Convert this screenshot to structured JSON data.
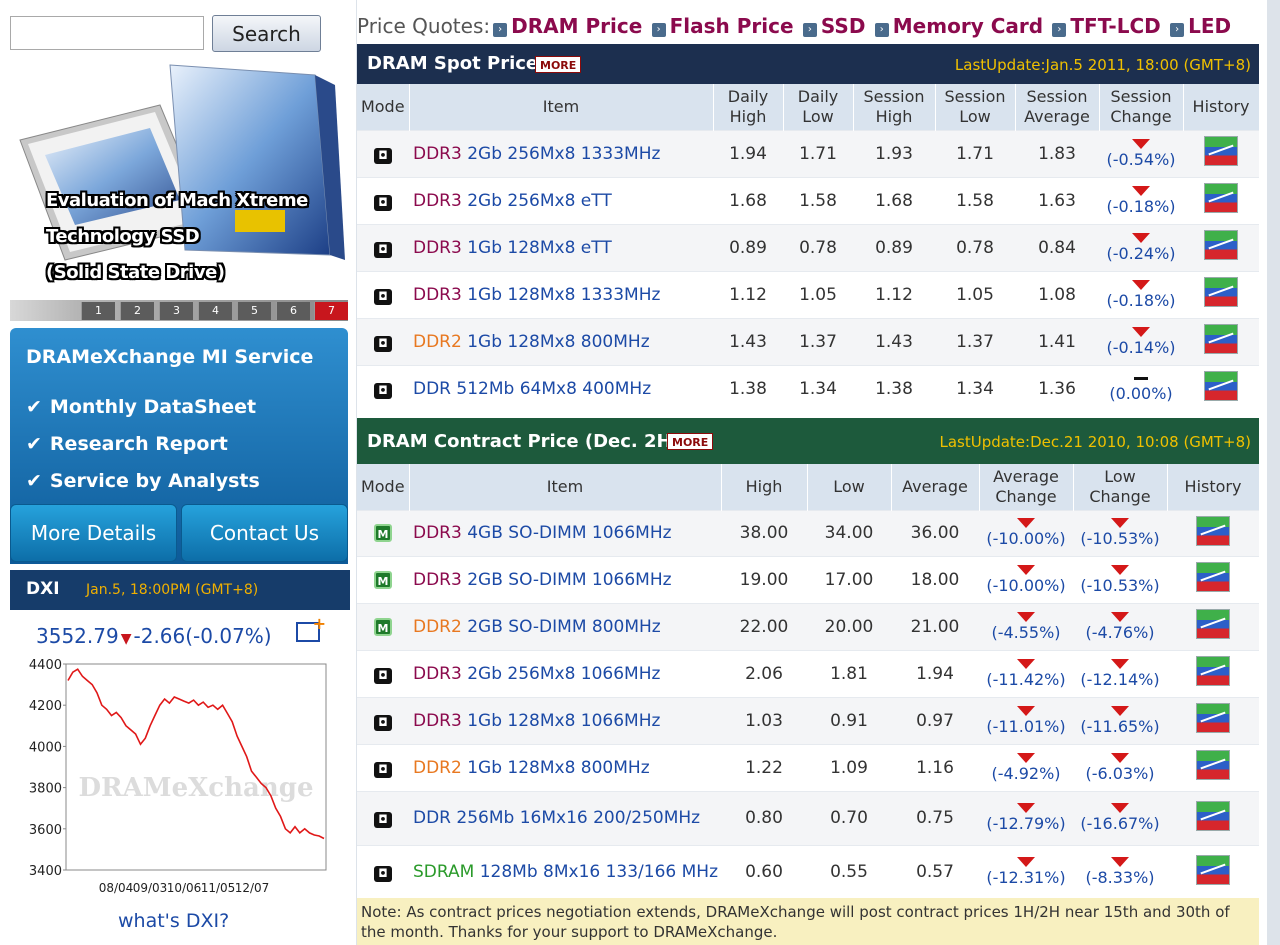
{
  "search": {
    "placeholder": "",
    "button": "Search"
  },
  "banner": {
    "caption_lines": [
      "Evaluation of Mach Xtreme",
      "Technology SSD",
      "(Solid State Drive)"
    ],
    "pages": [
      "1",
      "2",
      "3",
      "4",
      "5",
      "6",
      "7"
    ],
    "active_page": "7"
  },
  "mi_service": {
    "title": "DRAMeXchange MI Service",
    "items": [
      "Monthly DataSheet",
      "Research Report",
      "Service by Analysts"
    ],
    "more_details": "More Details",
    "contact_us": "Contact Us"
  },
  "dxi": {
    "name": "DXI",
    "timestamp": "Jan.5, 18:00PM (GMT+8)",
    "value": "3552.79",
    "change": "-2.66(-0.07%)",
    "whats_link": "what's DXI?"
  },
  "chart_data": {
    "type": "line",
    "watermark": "DRAMeXchange",
    "y_ticks": [
      "4400",
      "4200",
      "4000",
      "3800",
      "3600",
      "3400"
    ],
    "x_ticks": [
      "08/04",
      "09/03",
      "10/06",
      "11/05",
      "12/07"
    ],
    "ylim": [
      3400,
      4400
    ],
    "series": [
      {
        "values": [
          4320,
          4360,
          4375,
          4340,
          4320,
          4300,
          4260,
          4200,
          4180,
          4150,
          4165,
          4140,
          4100,
          4080,
          4060,
          4010,
          4040,
          4100,
          4150,
          4200,
          4230,
          4210,
          4240,
          4230,
          4220,
          4210,
          4225,
          4200,
          4215,
          4190,
          4200,
          4180,
          4200,
          4160,
          4120,
          4050,
          4000,
          3950,
          3880,
          3850,
          3820,
          3800,
          3760,
          3700,
          3660,
          3600,
          3580,
          3610,
          3580,
          3600,
          3580,
          3570,
          3565,
          3553
        ]
      }
    ]
  },
  "colors": {
    "navy": "#163c6a",
    "dark_blue_header": "#1c2f4f",
    "dark_green_header": "#1d5a3c",
    "accent_purple": "#8b0a4d",
    "down_red": "#d41818"
  },
  "quotes_nav": {
    "label": "Price Quotes:",
    "links": [
      "DRAM Price",
      "Flash Price",
      "SSD",
      "Memory Card",
      "TFT-LCD",
      "LED"
    ]
  },
  "spot": {
    "title": "DRAM Spot Price",
    "more": "MORE",
    "last_update": "LastUpdate:Jan.5 2011, 18:00 (GMT+8)",
    "headers": [
      "Mode",
      "Item",
      "Daily High",
      "Daily Low",
      "Session High",
      "Session Low",
      "Session Average",
      "Session Change",
      "History"
    ],
    "rows": [
      {
        "item_type": "DDR3",
        "item_spec": "2Gb 256Mx8 1333MHz",
        "daily_high": "1.94",
        "daily_low": "1.71",
        "session_high": "1.93",
        "session_low": "1.71",
        "session_avg": "1.83",
        "change": "(-0.54%)",
        "dir": "down"
      },
      {
        "item_type": "DDR3",
        "item_spec": "2Gb 256Mx8 eTT",
        "daily_high": "1.68",
        "daily_low": "1.58",
        "session_high": "1.68",
        "session_low": "1.58",
        "session_avg": "1.63",
        "change": "(-0.18%)",
        "dir": "down"
      },
      {
        "item_type": "DDR3",
        "item_spec": "1Gb 128Mx8 eTT",
        "daily_high": "0.89",
        "daily_low": "0.78",
        "session_high": "0.89",
        "session_low": "0.78",
        "session_avg": "0.84",
        "change": "(-0.24%)",
        "dir": "down"
      },
      {
        "item_type": "DDR3",
        "item_spec": "1Gb 128Mx8 1333MHz",
        "daily_high": "1.12",
        "daily_low": "1.05",
        "session_high": "1.12",
        "session_low": "1.05",
        "session_avg": "1.08",
        "change": "(-0.18%)",
        "dir": "down"
      },
      {
        "item_type": "DDR2",
        "item_spec": "1Gb 128Mx8 800MHz",
        "daily_high": "1.43",
        "daily_low": "1.37",
        "session_high": "1.43",
        "session_low": "1.37",
        "session_avg": "1.41",
        "change": "(-0.14%)",
        "dir": "down"
      },
      {
        "item_type": "DDR",
        "item_spec": "512Mb 64Mx8 400MHz",
        "daily_high": "1.38",
        "daily_low": "1.34",
        "session_high": "1.38",
        "session_low": "1.34",
        "session_avg": "1.36",
        "change": "(0.00%)",
        "dir": "flat"
      }
    ]
  },
  "contract": {
    "title": "DRAM Contract Price (Dec. 2H)",
    "more": "MORE",
    "last_update": "LastUpdate:Dec.21 2010, 10:08 (GMT+8)",
    "headers": [
      "Mode",
      "Item",
      "High",
      "Low",
      "Average",
      "Average Change",
      "Low Change",
      "History"
    ],
    "rows": [
      {
        "mode": "M",
        "item_type": "DDR3",
        "item_spec": "4GB SO-DIMM 1066MHz",
        "high": "38.00",
        "low": "34.00",
        "avg": "36.00",
        "avg_change": "(-10.00%)",
        "low_change": "(-10.53%)"
      },
      {
        "mode": "M",
        "item_type": "DDR3",
        "item_spec": "2GB SO-DIMM 1066MHz",
        "high": "19.00",
        "low": "17.00",
        "avg": "18.00",
        "avg_change": "(-10.00%)",
        "low_change": "(-10.53%)"
      },
      {
        "mode": "M",
        "item_type": "DDR2",
        "item_spec": "2GB SO-DIMM 800MHz",
        "high": "22.00",
        "low": "20.00",
        "avg": "21.00",
        "avg_change": "(-4.55%)",
        "low_change": "(-4.76%)"
      },
      {
        "mode": "C",
        "item_type": "DDR3",
        "item_spec": "2Gb 256Mx8 1066MHz",
        "high": "2.06",
        "low": "1.81",
        "avg": "1.94",
        "avg_change": "(-11.42%)",
        "low_change": "(-12.14%)"
      },
      {
        "mode": "C",
        "item_type": "DDR3",
        "item_spec": "1Gb 128Mx8 1066MHz",
        "high": "1.03",
        "low": "0.91",
        "avg": "0.97",
        "avg_change": "(-11.01%)",
        "low_change": "(-11.65%)"
      },
      {
        "mode": "C",
        "item_type": "DDR2",
        "item_spec": "1Gb 128Mx8 800MHz",
        "high": "1.22",
        "low": "1.09",
        "avg": "1.16",
        "avg_change": "(-4.92%)",
        "low_change": "(-6.03%)"
      },
      {
        "mode": "C",
        "item_type": "DDR",
        "item_spec": "256Mb 16Mx16 200/250MHz",
        "high": "0.80",
        "low": "0.70",
        "avg": "0.75",
        "avg_change": "(-12.79%)",
        "low_change": "(-16.67%)"
      },
      {
        "mode": "C",
        "item_type": "SDRAM",
        "item_spec": "128Mb 8Mx16 133/166 MHz",
        "high": "0.60",
        "low": "0.55",
        "avg": "0.57",
        "avg_change": "(-12.31%)",
        "low_change": "(-8.33%)"
      }
    ]
  },
  "note": "Note: As contract prices negotiation extends, DRAMeXchange will post contract prices 1H/2H near 15th and 30th of the month. Thanks for your support to DRAMeXchange."
}
